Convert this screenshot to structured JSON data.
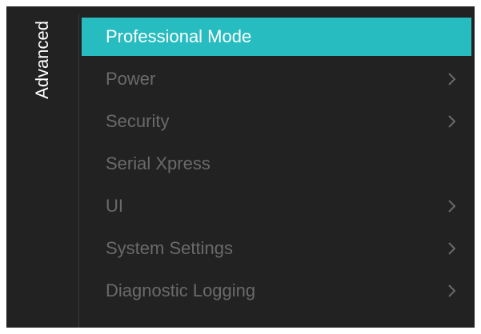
{
  "sidebar": {
    "title": "Advanced"
  },
  "menu": {
    "items": [
      {
        "label": "Professional Mode",
        "selected": true,
        "has_submenu": false
      },
      {
        "label": "Power",
        "selected": false,
        "has_submenu": true
      },
      {
        "label": "Security",
        "selected": false,
        "has_submenu": true
      },
      {
        "label": "Serial Xpress",
        "selected": false,
        "has_submenu": false
      },
      {
        "label": "UI",
        "selected": false,
        "has_submenu": true
      },
      {
        "label": "System Settings",
        "selected": false,
        "has_submenu": true
      },
      {
        "label": "Diagnostic Logging",
        "selected": false,
        "has_submenu": true
      }
    ]
  },
  "colors": {
    "background": "#222222",
    "accent": "#27bcc0",
    "inactive_text": "#6a6a6a",
    "active_text": "#ffffff"
  }
}
